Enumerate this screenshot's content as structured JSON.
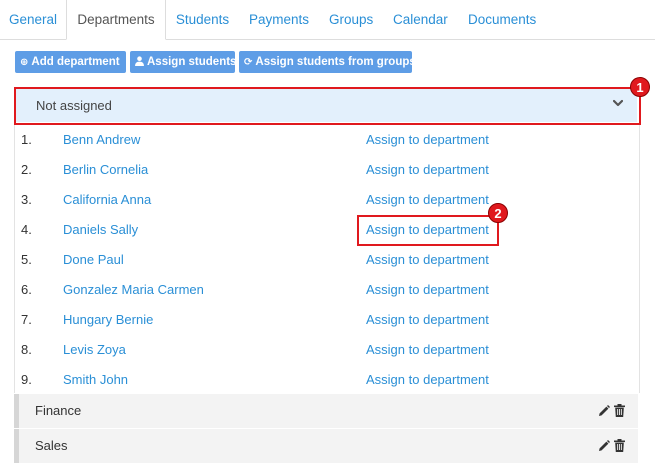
{
  "tabs": [
    "General",
    "Departments",
    "Students",
    "Payments",
    "Groups",
    "Calendar",
    "Documents"
  ],
  "toolbar": {
    "add_department": "Add department",
    "assign_students": "Assign students",
    "assign_from_groups": "Assign students from groups"
  },
  "not_assigned": {
    "title": "Not assigned",
    "students": [
      {
        "num": "1.",
        "name": "Benn Andrew",
        "action": "Assign to department"
      },
      {
        "num": "2.",
        "name": "Berlin Cornelia",
        "action": "Assign to department"
      },
      {
        "num": "3.",
        "name": "California Anna",
        "action": "Assign to department"
      },
      {
        "num": "4.",
        "name": "Daniels Sally",
        "action": "Assign to department"
      },
      {
        "num": "5.",
        "name": "Done Paul",
        "action": "Assign to department"
      },
      {
        "num": "6.",
        "name": "Gonzalez Maria Carmen",
        "action": "Assign to department"
      },
      {
        "num": "7.",
        "name": "Hungary Bernie",
        "action": "Assign to department"
      },
      {
        "num": "8.",
        "name": "Levis Zoya",
        "action": "Assign to department"
      },
      {
        "num": "9.",
        "name": "Smith John",
        "action": "Assign to department"
      }
    ]
  },
  "departments": [
    "Finance",
    "Sales"
  ],
  "callouts": [
    "1",
    "2"
  ],
  "colors": {
    "link": "#2a8fd6",
    "button": "#5e9de6",
    "highlight": "#e0191e",
    "panel": "#e3f0fc"
  }
}
